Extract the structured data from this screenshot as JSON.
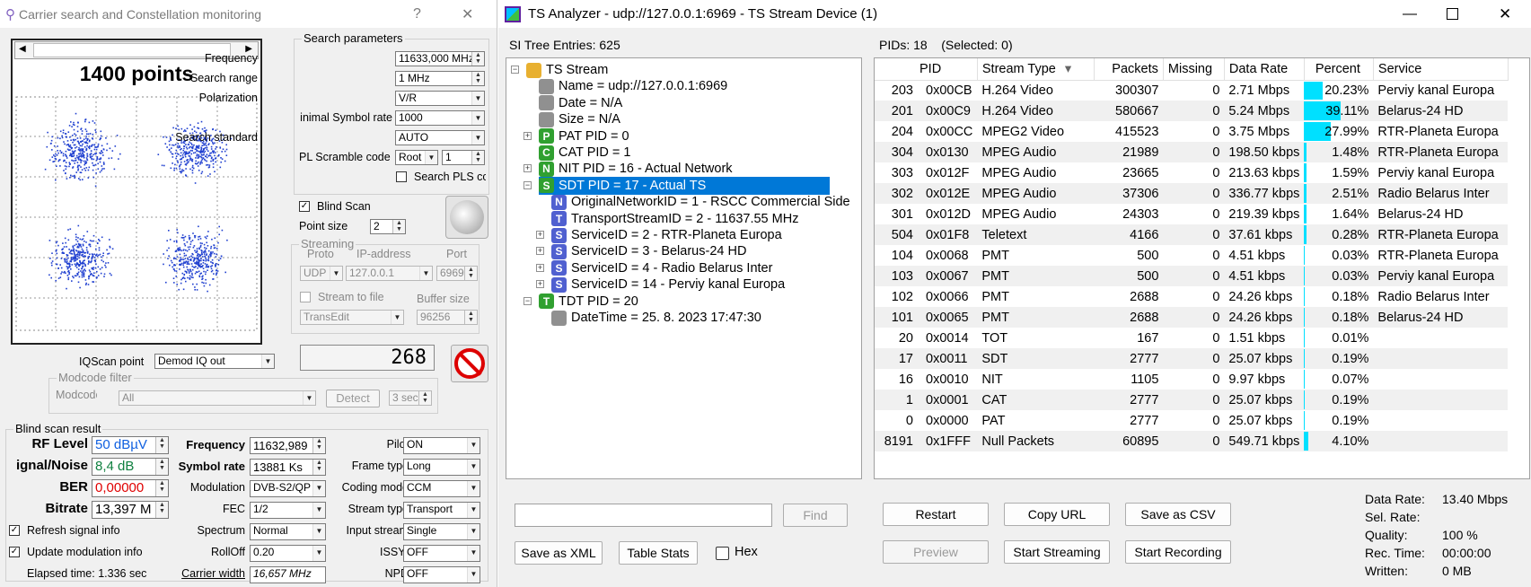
{
  "left": {
    "title": "Carrier search and Constellation monitoring",
    "help": "?",
    "close": "✕",
    "points_label": "1400 points",
    "search": {
      "group": "Search parameters",
      "frequency_label": "Frequency",
      "frequency": "11633,000 MHz",
      "range_label": "Search range",
      "range": "1 MHz",
      "polarization_label": "Polarization",
      "polarization": "V/R",
      "symrate_label": "inimal Symbol rate",
      "symrate": "1000",
      "standard_label": "Search standard",
      "standard": "AUTO",
      "pl_label": "PL Scramble code",
      "pl_mode": "Root",
      "pl_value": "1",
      "search_pls": "Search PLS cc"
    },
    "blind_scan": "Blind Scan",
    "point_size_label": "Point size",
    "point_size": "2",
    "streaming": {
      "group": "Streaming",
      "proto_label": "Proto",
      "ip_label": "IP-address",
      "port_label": "Port",
      "proto": "UDP",
      "ip": "127.0.0.1",
      "port": "6969",
      "stream_to_file": "Stream to file",
      "buffer_label": "Buffer size",
      "codec": "TransEdit",
      "buffer": "96256"
    },
    "counter": "268",
    "iqscan_label": "IQScan point",
    "iqscan": "Demod IQ out",
    "modcode": {
      "group": "Modcode filter",
      "label": "Modcode",
      "value": "All",
      "detect": "Detect",
      "secs": "3 sec"
    },
    "result": {
      "group": "Blind scan result",
      "rf_label": "RF Level",
      "rf": "50 dBµV",
      "sn_label": "ignal/Noise",
      "sn": "8,4 dB",
      "ber_label": "BER",
      "ber": "0,00000",
      "bitrate_label": "Bitrate",
      "bitrate": "13,397 M",
      "freq_label": "Frequency",
      "freq": "11632,989",
      "sr_label": "Symbol rate",
      "sr": "13881 Ks",
      "mod_label": "Modulation",
      "mod": "DVB-S2/QP",
      "fec_label": "FEC",
      "fec": "1/2",
      "spectrum_label": "Spectrum",
      "spectrum": "Normal",
      "rolloff_label": "RollOff",
      "rolloff": "0.20",
      "cw_label": "Carrier width",
      "cw": "16,657 MHz",
      "pilot_label": "Pilot",
      "pilot": "ON",
      "frame_label": "Frame type",
      "frame": "Long",
      "coding_label": "Coding mode",
      "coding": "CCM",
      "stype_label": "Stream type",
      "stype": "Transport",
      "input_label": "Input stream",
      "input": "Single",
      "issyi_label": "ISSYI",
      "issyi": "OFF",
      "npd_label": "NPD",
      "npd": "OFF",
      "refresh": "Refresh signal info",
      "update": "Update modulation info",
      "elapsed": "Elapsed time: 1.336 sec"
    }
  },
  "right": {
    "title": "TS Analyzer - udp://127.0.0.1:6969 - TS Stream Device (1)",
    "si_header": "SI Tree Entries: 625",
    "pids_header": "PIDs: 18    (Selected: 0)",
    "tree": [
      {
        "t": "TS Stream",
        "icon": "folder",
        "lvl": 0,
        "exp": "-"
      },
      {
        "t": "Name = udp://127.0.0.1:6969",
        "icon": "grey",
        "lvl": 1
      },
      {
        "t": "Date = N/A",
        "icon": "grey",
        "lvl": 1
      },
      {
        "t": "Size = N/A",
        "icon": "grey",
        "lvl": 1
      },
      {
        "t": "PAT PID = 0",
        "icon": "P",
        "lvl": 1,
        "exp": "+"
      },
      {
        "t": "CAT PID = 1",
        "icon": "C",
        "lvl": 1
      },
      {
        "t": "NIT PID = 16 - Actual Network",
        "icon": "N",
        "lvl": 1,
        "exp": "+"
      },
      {
        "t": "SDT PID = 17 - Actual TS",
        "icon": "S",
        "lvl": 1,
        "exp": "-",
        "sel": true
      },
      {
        "t": "OriginalNetworkID = 1 - RSCC Commercial Side",
        "icon": "N2",
        "lvl": 2
      },
      {
        "t": "TransportStreamID = 2 - 11637.55 MHz",
        "icon": "T",
        "lvl": 2
      },
      {
        "t": "ServiceID = 2 - RTR-Planeta Europa",
        "icon": "S2",
        "lvl": 2,
        "exp": "+"
      },
      {
        "t": "ServiceID = 3 - Belarus-24 HD",
        "icon": "S2",
        "lvl": 2,
        "exp": "+"
      },
      {
        "t": "ServiceID = 4 - Radio Belarus Inter",
        "icon": "S2",
        "lvl": 2,
        "exp": "+"
      },
      {
        "t": "ServiceID = 14 - Perviy kanal Europa",
        "icon": "S2",
        "lvl": 2,
        "exp": "+"
      },
      {
        "t": "TDT PID = 20",
        "icon": "T2",
        "lvl": 1,
        "exp": "-"
      },
      {
        "t": "DateTime = 25. 8. 2023 17:47:30",
        "icon": "grey",
        "lvl": 2
      }
    ],
    "columns": [
      "PID",
      "Stream Type",
      "Packets",
      "Missing",
      "Data Rate",
      "Percent",
      "Service"
    ],
    "rows": [
      [
        "203",
        "0x00CB",
        "H.264 Video",
        "300307",
        "0",
        "2.71 Mbps",
        20.23,
        "20.23%",
        "Perviy kanal Europa"
      ],
      [
        "201",
        "0x00C9",
        "H.264 Video",
        "580667",
        "0",
        "5.24 Mbps",
        39.11,
        "39.11%",
        "Belarus-24 HD"
      ],
      [
        "204",
        "0x00CC",
        "MPEG2 Video",
        "415523",
        "0",
        "3.75 Mbps",
        27.99,
        "27.99%",
        "RTR-Planeta Europa"
      ],
      [
        "304",
        "0x0130",
        "MPEG Audio",
        "21989",
        "0",
        "198.50 kbps",
        1.48,
        "1.48%",
        "RTR-Planeta Europa"
      ],
      [
        "303",
        "0x012F",
        "MPEG Audio",
        "23665",
        "0",
        "213.63 kbps",
        1.59,
        "1.59%",
        "Perviy kanal Europa"
      ],
      [
        "302",
        "0x012E",
        "MPEG Audio",
        "37306",
        "0",
        "336.77 kbps",
        2.51,
        "2.51%",
        "Radio Belarus Inter"
      ],
      [
        "301",
        "0x012D",
        "MPEG Audio",
        "24303",
        "0",
        "219.39 kbps",
        1.64,
        "1.64%",
        "Belarus-24 HD"
      ],
      [
        "504",
        "0x01F8",
        "Teletext",
        "4166",
        "0",
        "37.61 kbps",
        0.28,
        "0.28%",
        "RTR-Planeta Europa"
      ],
      [
        "104",
        "0x0068",
        "PMT",
        "500",
        "0",
        "4.51 kbps",
        0.03,
        "0.03%",
        "RTR-Planeta Europa"
      ],
      [
        "103",
        "0x0067",
        "PMT",
        "500",
        "0",
        "4.51 kbps",
        0.03,
        "0.03%",
        "Perviy kanal Europa"
      ],
      [
        "102",
        "0x0066",
        "PMT",
        "2688",
        "0",
        "24.26 kbps",
        0.18,
        "0.18%",
        "Radio Belarus Inter"
      ],
      [
        "101",
        "0x0065",
        "PMT",
        "2688",
        "0",
        "24.26 kbps",
        0.18,
        "0.18%",
        "Belarus-24 HD"
      ],
      [
        "20",
        "0x0014",
        "TOT",
        "167",
        "0",
        "1.51 kbps",
        0.01,
        "0.01%",
        ""
      ],
      [
        "17",
        "0x0011",
        "SDT",
        "2777",
        "0",
        "25.07 kbps",
        0.19,
        "0.19%",
        ""
      ],
      [
        "16",
        "0x0010",
        "NIT",
        "1105",
        "0",
        "9.97 kbps",
        0.07,
        "0.07%",
        ""
      ],
      [
        "1",
        "0x0001",
        "CAT",
        "2777",
        "0",
        "25.07 kbps",
        0.19,
        "0.19%",
        ""
      ],
      [
        "0",
        "0x0000",
        "PAT",
        "2777",
        "0",
        "25.07 kbps",
        0.19,
        "0.19%",
        ""
      ],
      [
        "8191",
        "0x1FFF",
        "Null Packets",
        "60895",
        "0",
        "549.71 kbps",
        4.1,
        "4.10%",
        ""
      ]
    ],
    "find": "Find",
    "save_xml": "Save as XML",
    "table_stats": "Table Stats",
    "hex": "Hex",
    "restart": "Restart",
    "copy_url": "Copy URL",
    "save_csv": "Save as CSV",
    "preview": "Preview",
    "start_streaming": "Start Streaming",
    "start_recording": "Start Recording",
    "stats": {
      "dr_label": "Data Rate:",
      "dr": "13.40 Mbps",
      "sel_label": "Sel. Rate:",
      "sel": "",
      "q_label": "Quality:",
      "q": "100 %",
      "rec_label": "Rec. Time:",
      "rec": "00:00:00",
      "wr_label": "Written:",
      "wr": "0 MB"
    }
  }
}
